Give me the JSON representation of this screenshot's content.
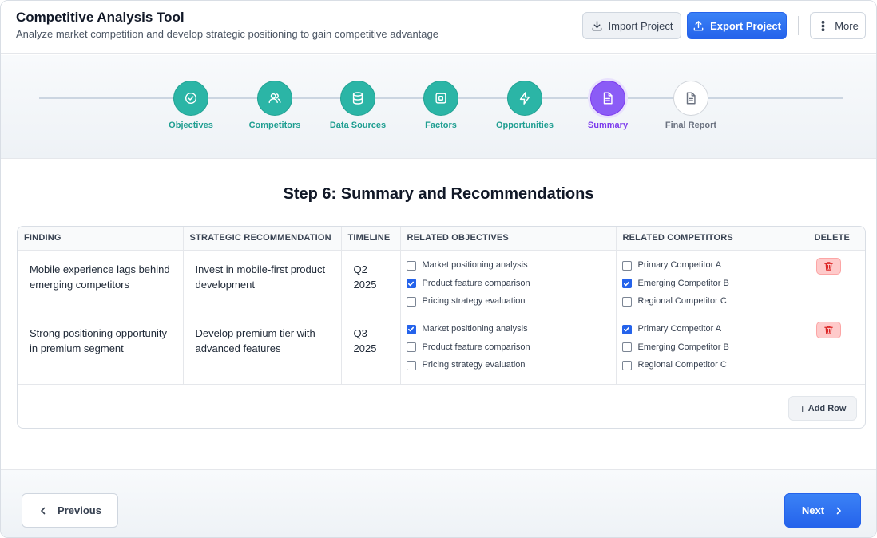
{
  "header": {
    "title": "Competitive Analysis Tool",
    "subtitle": "Analyze market competition and develop strategic positioning to gain competitive advantage",
    "import_label": "Import Project",
    "export_label": "Export Project",
    "more_label": "More"
  },
  "steps": [
    {
      "label": "Objectives",
      "icon": "check-circle-icon",
      "state": "done"
    },
    {
      "label": "Competitors",
      "icon": "users-icon",
      "state": "done"
    },
    {
      "label": "Data Sources",
      "icon": "database-icon",
      "state": "done"
    },
    {
      "label": "Factors",
      "icon": "square-target-icon",
      "state": "done"
    },
    {
      "label": "Opportunities",
      "icon": "lightning-icon",
      "state": "done"
    },
    {
      "label": "Summary",
      "icon": "document-icon",
      "state": "active"
    },
    {
      "label": "Final Report",
      "icon": "document-icon",
      "state": "todo"
    }
  ],
  "main": {
    "step_title": "Step 6: Summary and Recommendations",
    "columns": [
      "FINDING",
      "STRATEGIC RECOMMENDATION",
      "TIMELINE",
      "RELATED OBJECTIVES",
      "RELATED COMPETITORS",
      "DELETE"
    ],
    "rows": [
      {
        "finding": "Mobile experience lags behind emerging competitors",
        "recommendation": "Invest in mobile-first product development",
        "timeline": "Q2 2025",
        "objectives": [
          {
            "label": "Market positioning analysis",
            "checked": false
          },
          {
            "label": "Product feature comparison",
            "checked": true
          },
          {
            "label": "Pricing strategy evaluation",
            "checked": false
          }
        ],
        "competitors": [
          {
            "label": "Primary Competitor A",
            "checked": false
          },
          {
            "label": "Emerging Competitor B",
            "checked": true
          },
          {
            "label": "Regional Competitor C",
            "checked": false
          }
        ]
      },
      {
        "finding": "Strong positioning opportunity in premium segment",
        "recommendation": "Develop premium tier with advanced features",
        "timeline": "Q3 2025",
        "objectives": [
          {
            "label": "Market positioning analysis",
            "checked": true
          },
          {
            "label": "Product feature comparison",
            "checked": false
          },
          {
            "label": "Pricing strategy evaluation",
            "checked": false
          }
        ],
        "competitors": [
          {
            "label": "Primary Competitor A",
            "checked": true
          },
          {
            "label": "Emerging Competitor B",
            "checked": false
          },
          {
            "label": "Regional Competitor C",
            "checked": false
          }
        ]
      }
    ],
    "add_row_label": "Add Row"
  },
  "footer": {
    "previous_label": "Previous",
    "next_label": "Next"
  },
  "colors": {
    "accent": "#2563eb",
    "done": "#2bb5a6",
    "active": "#8b5cf6",
    "danger": "#dc2626"
  }
}
